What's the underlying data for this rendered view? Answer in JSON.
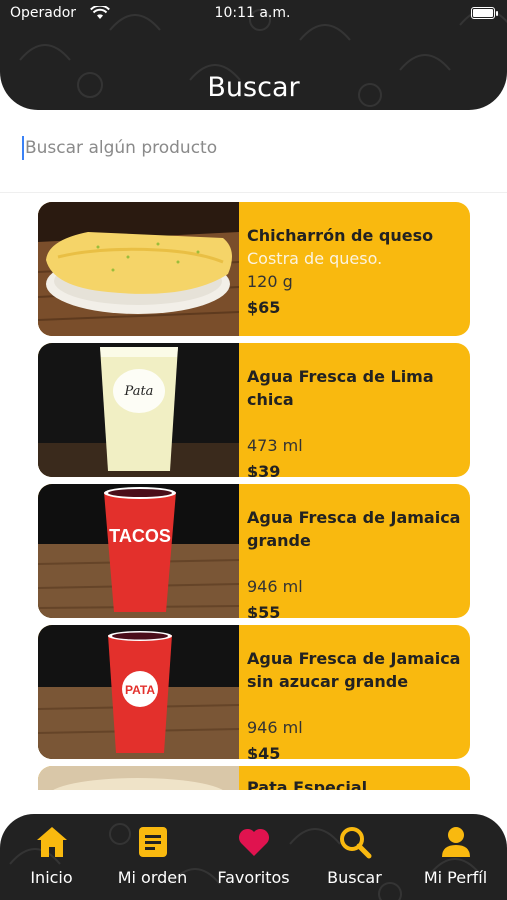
{
  "status": {
    "carrier": "Operador",
    "time": "10:11 a.m."
  },
  "header": {
    "title": "Buscar"
  },
  "search": {
    "placeholder": "Buscar algún producto",
    "value": ""
  },
  "products": [
    {
      "name": "Chicharrón de queso",
      "description": "Costra de queso.",
      "size": "120 g",
      "price": "$65",
      "image": "cheese-crisp"
    },
    {
      "name": "Agua Fresca de Lima chica",
      "description": "",
      "size": "473 ml",
      "price": "$39",
      "image": "lime-drink-glass"
    },
    {
      "name": "Agua Fresca de Jamaica grande",
      "description": "",
      "size": "946 ml",
      "price": "$55",
      "image": "red-cup-tacos"
    },
    {
      "name": "Agua Fresca de Jamaica sin azucar grande",
      "description": "",
      "size": "946 ml",
      "price": "$45",
      "image": "red-cup-pata"
    },
    {
      "name": "Pata Especial",
      "description": "",
      "size": "",
      "price": "",
      "image": "tortilla"
    }
  ],
  "nav": {
    "items": [
      {
        "label": "Inicio",
        "icon": "home-icon"
      },
      {
        "label": "Mi orden",
        "icon": "order-list-icon"
      },
      {
        "label": "Favoritos",
        "icon": "heart-icon"
      },
      {
        "label": "Buscar",
        "icon": "search-icon"
      },
      {
        "label": "Mi Perfíl",
        "icon": "user-icon"
      }
    ]
  },
  "colors": {
    "accent": "#f9b90f",
    "dark": "#222222",
    "heart": "#e0134f"
  }
}
